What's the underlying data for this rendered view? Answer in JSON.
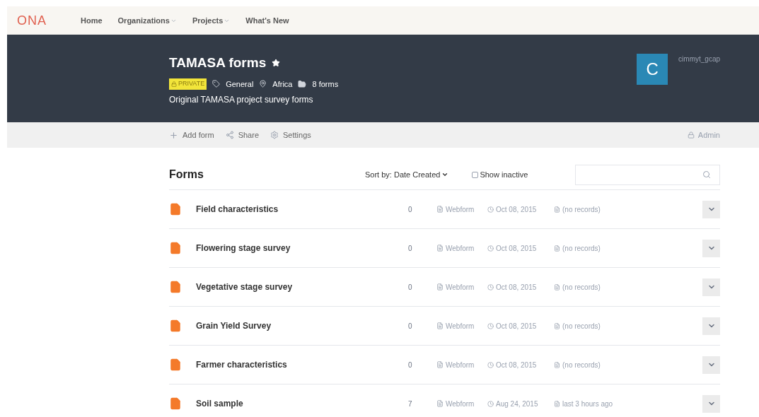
{
  "logo": "ONA",
  "nav": [
    {
      "label": "Home",
      "dropdown": false
    },
    {
      "label": "Organizations",
      "dropdown": true
    },
    {
      "label": "Projects",
      "dropdown": true
    },
    {
      "label": "What's New",
      "dropdown": false
    }
  ],
  "project": {
    "title": "TAMASA forms",
    "starred": true,
    "badge": "PRIVATE",
    "tag": "General",
    "location": "Africa",
    "forms_count": "8 forms",
    "description": "Original TAMASA project survey forms",
    "avatar_letter": "C",
    "owner": "cimmyt_gcap"
  },
  "actions": [
    {
      "kind": "add",
      "label": "Add form"
    },
    {
      "kind": "share",
      "label": "Share"
    },
    {
      "kind": "settings",
      "label": "Settings"
    }
  ],
  "role": "Admin",
  "forms_heading": "Forms",
  "sort": "Sort by: Date Created",
  "show_inactive": {
    "label": "Show inactive",
    "checked": false
  },
  "forms": [
    {
      "name": "Field characteristics",
      "count": "0",
      "type": "Webform",
      "date": "Oct 08, 2015",
      "records": "(no records)"
    },
    {
      "name": "Flowering stage survey",
      "count": "0",
      "type": "Webform",
      "date": "Oct 08, 2015",
      "records": "(no records)"
    },
    {
      "name": "Vegetative stage survey",
      "count": "0",
      "type": "Webform",
      "date": "Oct 08, 2015",
      "records": "(no records)"
    },
    {
      "name": "Grain Yield Survey",
      "count": "0",
      "type": "Webform",
      "date": "Oct 08, 2015",
      "records": "(no records)"
    },
    {
      "name": "Farmer characteristics",
      "count": "0",
      "type": "Webform",
      "date": "Oct 08, 2015",
      "records": "(no records)"
    },
    {
      "name": "Soil sample",
      "count": "7",
      "type": "Webform",
      "date": "Aug 24, 2015",
      "records": "last 3 hours ago"
    }
  ]
}
